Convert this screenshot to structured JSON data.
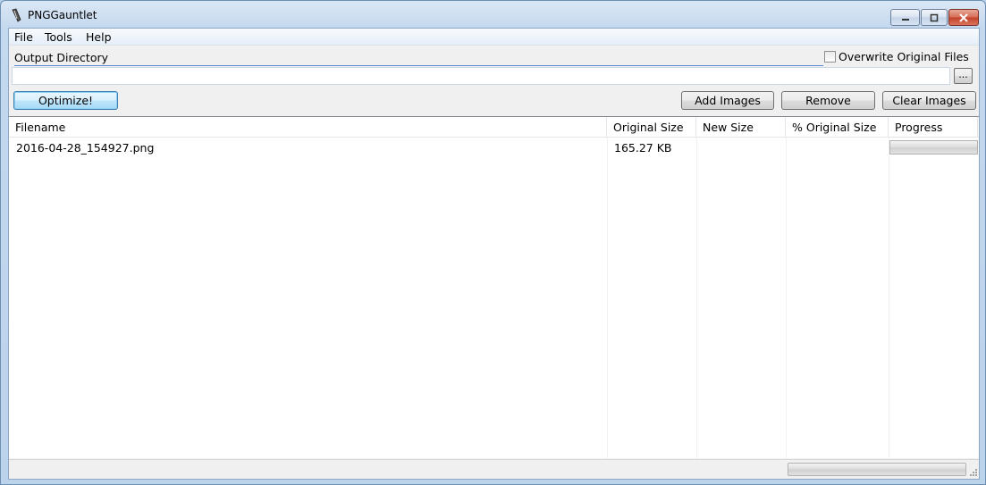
{
  "window": {
    "title": "PNGGauntlet"
  },
  "menu": {
    "file": "File",
    "tools": "Tools",
    "help": "Help"
  },
  "output": {
    "label": "Output Directory",
    "value": "",
    "browse_label": "...",
    "overwrite_label": "Overwrite Original Files",
    "overwrite_checked": false
  },
  "buttons": {
    "optimize": "Optimize!",
    "add_images": "Add Images",
    "remove": "Remove",
    "clear_images": "Clear Images"
  },
  "table": {
    "columns": [
      "Filename",
      "Original Size",
      "New Size",
      "% Original Size",
      "Progress"
    ],
    "rows": [
      {
        "filename": "2016-04-28_154927.png",
        "original_size": "165.27 KB",
        "new_size": "",
        "pct_original": "",
        "progress": 0
      }
    ]
  },
  "status": {
    "progress": 0
  },
  "icons": {
    "app": "pen-nib-icon",
    "minimize": "minimize-icon",
    "maximize": "maximize-icon",
    "close": "close-icon",
    "grip": "resize-grip-icon"
  },
  "colors": {
    "accent": "#3c7fb1",
    "title_bar": "#c4d8ee",
    "close_button": "#c2412a"
  }
}
